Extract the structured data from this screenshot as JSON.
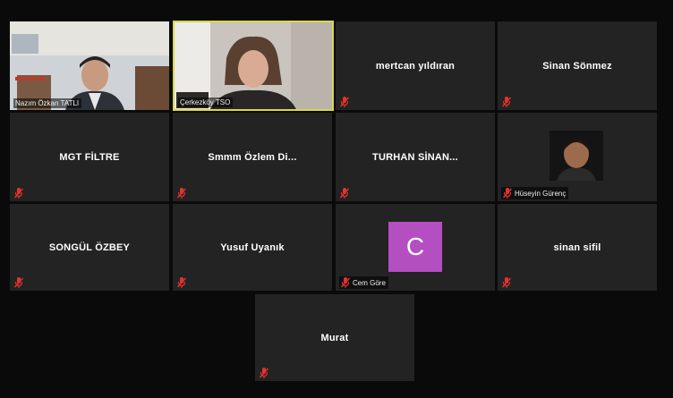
{
  "participants": [
    {
      "name": "Nazım Özkan TATLI",
      "type": "video"
    },
    {
      "name": "Çerkezköy TSO",
      "type": "video"
    },
    {
      "name": "mertcan yıldıran",
      "type": "name"
    },
    {
      "name": "Sinan Sönmez",
      "type": "name"
    },
    {
      "name": "MGT FİLTRE",
      "type": "name"
    },
    {
      "name": "Smmm Özlem Di...",
      "type": "name"
    },
    {
      "name": "TURHAN SİNAN...",
      "type": "name"
    },
    {
      "name": "Hüseyin Gürenç",
      "type": "photo"
    },
    {
      "name": "SONGÜL ÖZBEY",
      "type": "name"
    },
    {
      "name": "Yusuf Uyanık",
      "type": "name"
    },
    {
      "name": "Cem Göre",
      "type": "avatar",
      "initial": "C"
    },
    {
      "name": "sinan sifil",
      "type": "name"
    },
    {
      "name": "Murat",
      "type": "name"
    }
  ],
  "colors": {
    "tile": "#232323",
    "active_border": "#d7d84a",
    "avatar": "#b44fc2",
    "muted_icon": "#e5322d"
  },
  "icons": {
    "muted": "mic-muted-icon"
  }
}
